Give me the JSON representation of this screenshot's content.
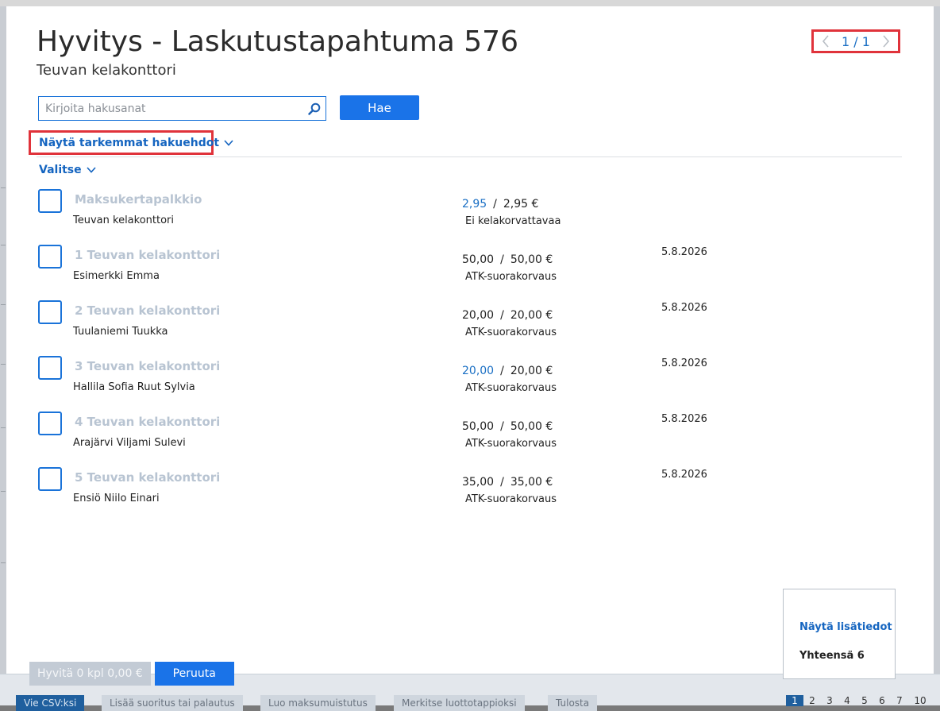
{
  "modal": {
    "title": "Hyvitys - Laskutustapahtuma 576",
    "subtitle": "Teuvan kelakonttori",
    "pager": {
      "count": "1 / 1"
    },
    "search": {
      "placeholder": "Kirjoita hakusanat",
      "value": ""
    },
    "search_button": "Hae",
    "advanced_toggle": "Näytä tarkemmat hakuehdot",
    "select_menu": "Valitse",
    "rows": [
      {
        "name": "Maksukertapalkkio",
        "person": "Teuvan kelakonttori",
        "amount": "2,95",
        "total": "2,95 €",
        "type": "Ei kelakorvattavaa",
        "date": ""
      },
      {
        "name": "1 Teuvan kelakonttori",
        "person": "Esimerkki Emma",
        "amount": "50,00",
        "total": "50,00 €",
        "type": "ATK-suorakorvaus",
        "date": "5.8.2026"
      },
      {
        "name": "2 Teuvan kelakonttori",
        "person": "Tuulaniemi Tuukka",
        "amount": "20,00",
        "total": "20,00 €",
        "type": "ATK-suorakorvaus",
        "date": "5.8.2026"
      },
      {
        "name": "3 Teuvan kelakonttori",
        "person": "Hallila Sofia Ruut Sylvia",
        "amount": "20,00",
        "total": "20,00 €",
        "type": "ATK-suorakorvaus",
        "date": "5.8.2026"
      },
      {
        "name": "4 Teuvan kelakonttori",
        "person": "Arajärvi Viljami Sulevi",
        "amount": "50,00",
        "total": "50,00 €",
        "type": "ATK-suorakorvaus",
        "date": "5.8.2026"
      },
      {
        "name": "5 Teuvan kelakonttori",
        "person": "Ensiö Niilo Einari",
        "amount": "35,00",
        "total": "35,00 €",
        "type": "ATK-suorakorvaus",
        "date": "5.8.2026"
      }
    ],
    "info_box": {
      "more_link": "Näytä lisätiedot",
      "total": "Yhteensä 6"
    },
    "footer": {
      "credit_button": "Hyvitä 0 kpl 0,00 €",
      "cancel_button": "Peruuta"
    }
  },
  "background": {
    "buttons": [
      "Vie CSV:ksi",
      "Lisää suoritus tai palautus",
      "Luo maksumuistutus",
      "Merkitse luottotappioksi",
      "Tulosta"
    ],
    "pages": [
      "1",
      "2",
      "3",
      "4",
      "5",
      "6",
      "7",
      "10"
    ]
  },
  "colors": {
    "accent": "#1a73e8",
    "link": "#1565c0",
    "highlight_border": "#e0333b",
    "muted_title": "#b8c4d2"
  }
}
